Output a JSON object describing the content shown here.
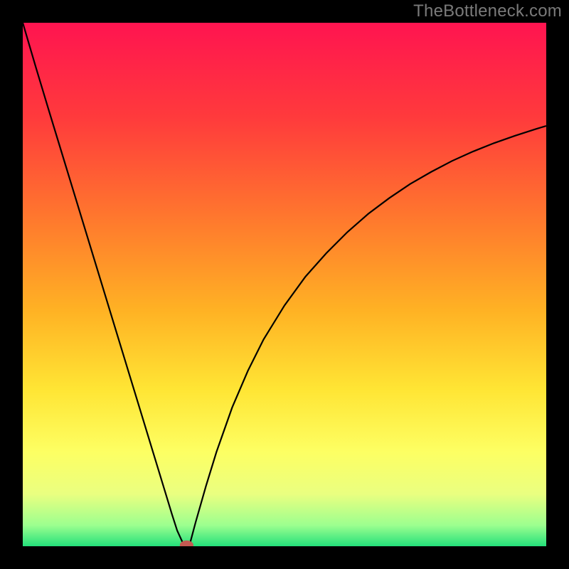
{
  "watermark": "TheBottleneck.com",
  "chart_data": {
    "type": "line",
    "title": "",
    "xlabel": "",
    "ylabel": "",
    "xlim": [
      0,
      100
    ],
    "ylim": [
      0,
      100
    ],
    "background_gradient": {
      "stops": [
        {
          "offset": 0,
          "color": "#ff1450"
        },
        {
          "offset": 18,
          "color": "#ff3a3c"
        },
        {
          "offset": 38,
          "color": "#ff7a2d"
        },
        {
          "offset": 55,
          "color": "#ffb224"
        },
        {
          "offset": 70,
          "color": "#ffe534"
        },
        {
          "offset": 82,
          "color": "#fdff63"
        },
        {
          "offset": 90,
          "color": "#eaff80"
        },
        {
          "offset": 96,
          "color": "#9cff8f"
        },
        {
          "offset": 100,
          "color": "#24e07b"
        }
      ]
    },
    "series": [
      {
        "name": "left-branch",
        "x": [
          0.0,
          2.5,
          5.0,
          7.5,
          10.0,
          12.5,
          15.0,
          17.5,
          20.0,
          22.5,
          25.0,
          27.5,
          28.5,
          29.5,
          30.5,
          31.0
        ],
        "y": [
          100.0,
          91.5,
          83.2,
          75.0,
          66.8,
          58.6,
          50.4,
          42.2,
          34.0,
          25.8,
          17.6,
          9.4,
          6.1,
          3.0,
          0.8,
          0.0
        ]
      },
      {
        "name": "right-branch",
        "x": [
          31.8,
          33.0,
          35.0,
          37.0,
          40.0,
          43.0,
          46.0,
          50.0,
          54.0,
          58.0,
          62.0,
          66.0,
          70.0,
          74.0,
          78.0,
          82.0,
          86.0,
          90.0,
          94.0,
          98.0,
          100.0
        ],
        "y": [
          0.0,
          4.5,
          11.5,
          18.0,
          26.5,
          33.5,
          39.5,
          46.0,
          51.5,
          56.0,
          60.0,
          63.5,
          66.5,
          69.2,
          71.5,
          73.6,
          75.4,
          77.0,
          78.4,
          79.7,
          80.3
        ]
      }
    ],
    "marker": {
      "name": "minimum-point",
      "x": 31.3,
      "y": 0.2,
      "color": "#c45a52",
      "rx": 1.3,
      "ry": 0.9
    },
    "grid": false,
    "legend": false
  }
}
